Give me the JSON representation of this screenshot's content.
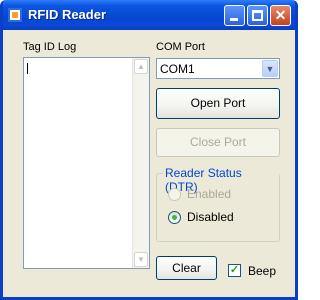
{
  "window": {
    "title": "RFID Reader"
  },
  "log": {
    "label": "Tag ID Log",
    "content": ""
  },
  "com": {
    "label": "COM Port",
    "selected": "COM1"
  },
  "buttons": {
    "open": "Open Port",
    "close": "Close Port",
    "clear": "Clear"
  },
  "status": {
    "title": "Reader Status (DTR)",
    "options": [
      {
        "label": "Enabled",
        "selected": false,
        "enabled": false
      },
      {
        "label": "Disabled",
        "selected": true,
        "enabled": true
      }
    ]
  },
  "beep": {
    "label": "Beep",
    "checked": true
  },
  "colors": {
    "titlebar": "#0a55e0",
    "accent_green": "#3cba3c",
    "groupbox_title": "#0046d5"
  },
  "icons": [
    "app-icon",
    "minimize-icon",
    "maximize-icon",
    "close-icon",
    "scroll-up-icon",
    "scroll-down-icon",
    "dropdown-arrow-icon",
    "checkmark-icon"
  ]
}
